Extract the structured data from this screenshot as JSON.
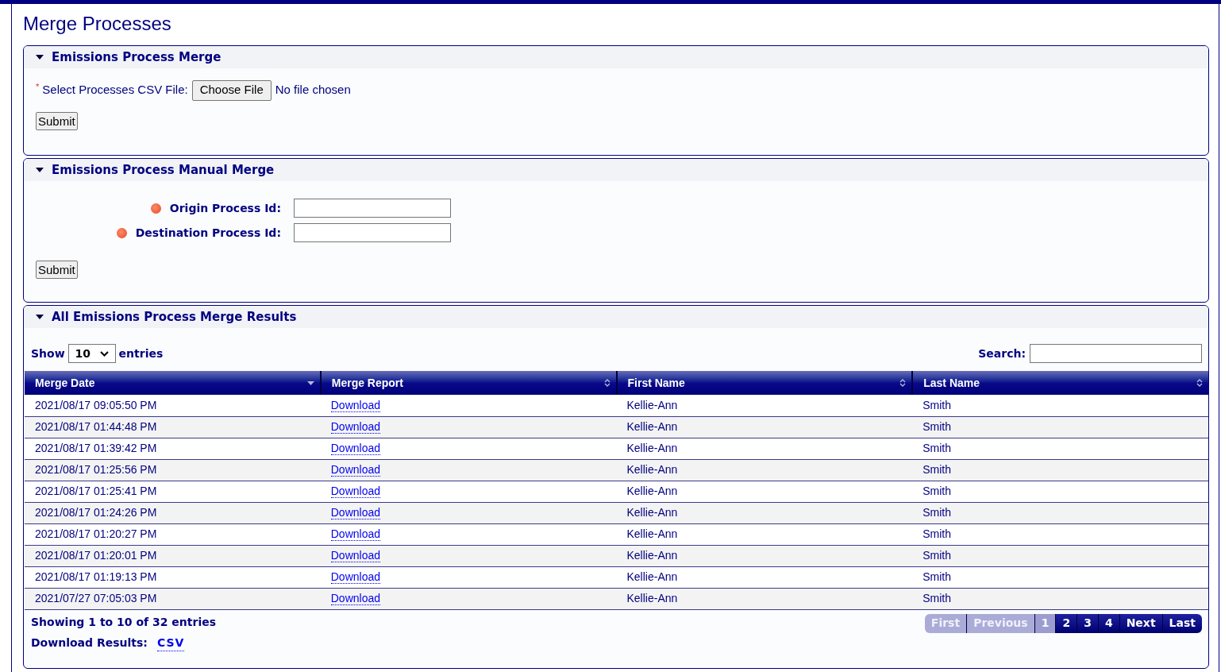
{
  "page_title": "Merge Processes",
  "file_merge": {
    "title": "Emissions Process Merge",
    "expanded": true,
    "required_mark": "*",
    "label": "Select Processes CSV File:",
    "choose_button": "Choose File",
    "file_status": "No file chosen",
    "submit": "Submit"
  },
  "manual_merge": {
    "title": "Emissions Process Manual Merge",
    "expanded": true,
    "fields": [
      {
        "label": "Origin Process Id:",
        "required": true
      },
      {
        "label": "Destination Process Id:",
        "required": true
      }
    ],
    "submit": "Submit"
  },
  "results": {
    "title": "All Emissions Process Merge Results",
    "expanded": true,
    "show_label": "Show",
    "page_size": "10",
    "entries_label": "entries",
    "search_label": "Search:",
    "columns": [
      {
        "label": "Merge Date",
        "sorted": true
      },
      {
        "label": "Merge Report",
        "sorted": false
      },
      {
        "label": "First Name",
        "sorted": false
      },
      {
        "label": "Last Name",
        "sorted": false
      }
    ],
    "rows": [
      [
        "2021/08/17 09:05:50 PM",
        "Download",
        "Kellie-Ann",
        "Smith"
      ],
      [
        "2021/08/17 01:44:48 PM",
        "Download",
        "Kellie-Ann",
        "Smith"
      ],
      [
        "2021/08/17 01:39:42 PM",
        "Download",
        "Kellie-Ann",
        "Smith"
      ],
      [
        "2021/08/17 01:25:56 PM",
        "Download",
        "Kellie-Ann",
        "Smith"
      ],
      [
        "2021/08/17 01:25:41 PM",
        "Download",
        "Kellie-Ann",
        "Smith"
      ],
      [
        "2021/08/17 01:24:26 PM",
        "Download",
        "Kellie-Ann",
        "Smith"
      ],
      [
        "2021/08/17 01:20:27 PM",
        "Download",
        "Kellie-Ann",
        "Smith"
      ],
      [
        "2021/08/17 01:20:01 PM",
        "Download",
        "Kellie-Ann",
        "Smith"
      ],
      [
        "2021/08/17 01:19:13 PM",
        "Download",
        "Kellie-Ann",
        "Smith"
      ],
      [
        "2021/07/27 07:05:03 PM",
        "Download",
        "Kellie-Ann",
        "Smith"
      ]
    ],
    "info": "Showing 1 to 10 of 32 entries",
    "download_label": "Download Results:",
    "download_link": "CSV",
    "pager": [
      {
        "label": "First",
        "disabled": true,
        "selected": false
      },
      {
        "label": "Previous",
        "disabled": true,
        "selected": false
      },
      {
        "label": "1",
        "disabled": false,
        "selected": true
      },
      {
        "label": "2",
        "disabled": false,
        "selected": false
      },
      {
        "label": "3",
        "disabled": false,
        "selected": false
      },
      {
        "label": "4",
        "disabled": false,
        "selected": false
      },
      {
        "label": "Next",
        "disabled": false,
        "selected": false
      },
      {
        "label": "Last",
        "disabled": false,
        "selected": false
      }
    ]
  }
}
